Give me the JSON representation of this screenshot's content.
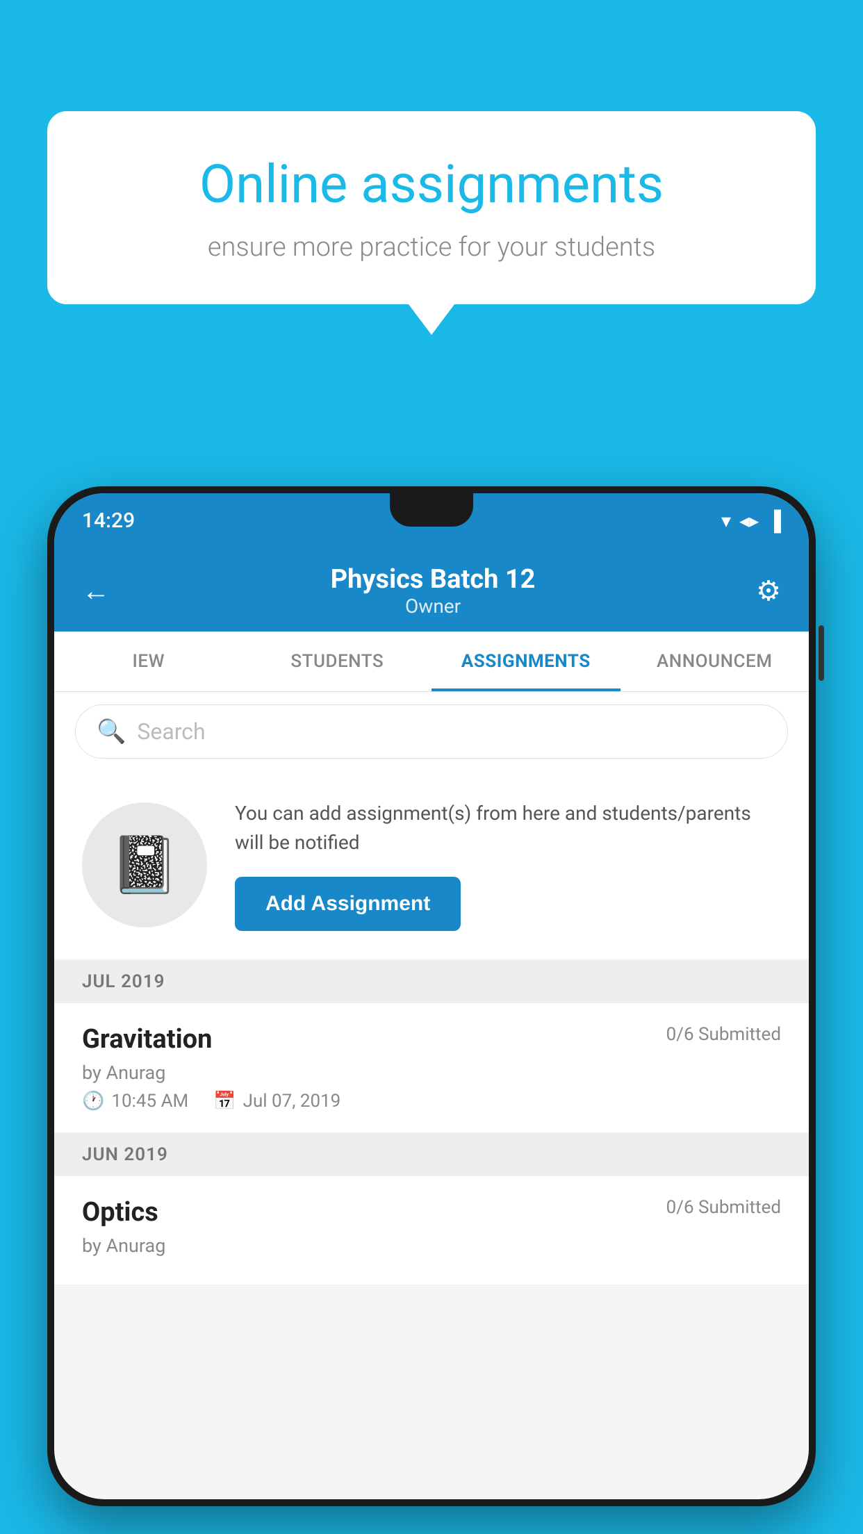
{
  "background_color": "#1ab9e8",
  "speech_bubble": {
    "title": "Online assignments",
    "subtitle": "ensure more practice for your students"
  },
  "phone": {
    "status_bar": {
      "time": "14:29",
      "icons": [
        "▼",
        "◀",
        "▌"
      ]
    },
    "header": {
      "back_label": "←",
      "title": "Physics Batch 12",
      "subtitle": "Owner",
      "gear_label": "⚙"
    },
    "tabs": [
      {
        "label": "IEW",
        "active": false
      },
      {
        "label": "STUDENTS",
        "active": false
      },
      {
        "label": "ASSIGNMENTS",
        "active": true
      },
      {
        "label": "ANNOUNCEM",
        "active": false
      }
    ],
    "search": {
      "placeholder": "Search"
    },
    "cta_section": {
      "icon": "📓",
      "text": "You can add assignment(s) from here and students/parents will be notified",
      "button_label": "Add Assignment"
    },
    "sections": [
      {
        "month_label": "JUL 2019",
        "assignments": [
          {
            "name": "Gravitation",
            "submitted": "0/6 Submitted",
            "by": "by Anurag",
            "time": "10:45 AM",
            "date": "Jul 07, 2019"
          }
        ]
      },
      {
        "month_label": "JUN 2019",
        "assignments": [
          {
            "name": "Optics",
            "submitted": "0/6 Submitted",
            "by": "by Anurag",
            "time": "",
            "date": ""
          }
        ]
      }
    ]
  }
}
